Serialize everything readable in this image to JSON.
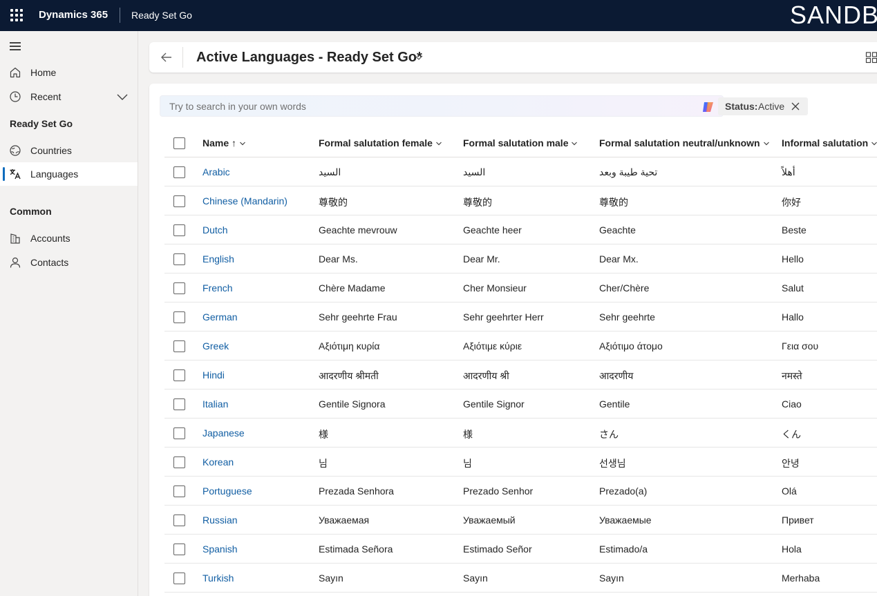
{
  "topbar": {
    "app_name": "Dynamics 365",
    "module_name": "Ready Set Go",
    "environment_label": "SANDBOX"
  },
  "sidebar": {
    "items_top": [
      {
        "label": "Home",
        "icon": "home-icon"
      },
      {
        "label": "Recent",
        "icon": "clock-icon"
      }
    ],
    "group1": {
      "title": "Ready Set Go",
      "items": [
        {
          "label": "Countries",
          "icon": "globe-icon"
        },
        {
          "label": "Languages",
          "icon": "translate-icon",
          "active": true
        }
      ]
    },
    "group2": {
      "title": "Common",
      "items": [
        {
          "label": "Accounts",
          "icon": "building-icon"
        },
        {
          "label": "Contacts",
          "icon": "person-icon"
        }
      ]
    }
  },
  "header": {
    "view_title": "Active Languages - Ready Set Go*"
  },
  "search": {
    "placeholder": "Try to search in your own words"
  },
  "filter_chip": {
    "key": "Status:",
    "value": "Active"
  },
  "table": {
    "columns": [
      {
        "label": "Name ↑"
      },
      {
        "label": "Formal salutation female"
      },
      {
        "label": "Formal salutation male"
      },
      {
        "label": "Formal salutation neutral/unknown"
      },
      {
        "label": "Informal salutation"
      }
    ],
    "rows": [
      [
        "Arabic",
        "السيد",
        "السيد",
        "تحية طيبة وبعد",
        "أهلاً"
      ],
      [
        "Chinese (Mandarin)",
        "尊敬的",
        "尊敬的",
        "尊敬的",
        "你好"
      ],
      [
        "Dutch",
        "Geachte mevrouw",
        "Geachte heer",
        "Geachte",
        "Beste"
      ],
      [
        "English",
        "Dear Ms.",
        "Dear Mr.",
        "Dear Mx.",
        "Hello"
      ],
      [
        "French",
        "Chère Madame",
        "Cher Monsieur",
        "Cher/Chère",
        "Salut"
      ],
      [
        "German",
        "Sehr geehrte Frau",
        "Sehr geehrter Herr",
        "Sehr geehrte",
        "Hallo"
      ],
      [
        "Greek",
        "Αξιότιμη κυρία",
        "Αξιότιμε κύριε",
        "Αξιότιμο άτομο",
        "Γεια σου"
      ],
      [
        "Hindi",
        "आदरणीय श्रीमती",
        "आदरणीय श्री",
        "आदरणीय",
        "नमस्ते"
      ],
      [
        "Italian",
        "Gentile Signora",
        "Gentile Signor",
        "Gentile",
        "Ciao"
      ],
      [
        "Japanese",
        "様",
        "様",
        "さん",
        "くん"
      ],
      [
        "Korean",
        "님",
        "님",
        "선생님",
        "안녕"
      ],
      [
        "Portuguese",
        "Prezada Senhora",
        "Prezado Senhor",
        "Prezado(a)",
        "Olá"
      ],
      [
        "Russian",
        "Уважаемая",
        "Уважаемый",
        "Уважаемые",
        "Привет"
      ],
      [
        "Spanish",
        "Estimada Señora",
        "Estimado Señor",
        "Estimado/a",
        "Hola"
      ],
      [
        "Turkish",
        "Sayın",
        "Sayın",
        "Sayın",
        "Merhaba"
      ]
    ]
  },
  "colors": {
    "topbar_bg": "#0b1a33",
    "link": "#115ea3",
    "active_indicator": "#0f6cbd"
  }
}
